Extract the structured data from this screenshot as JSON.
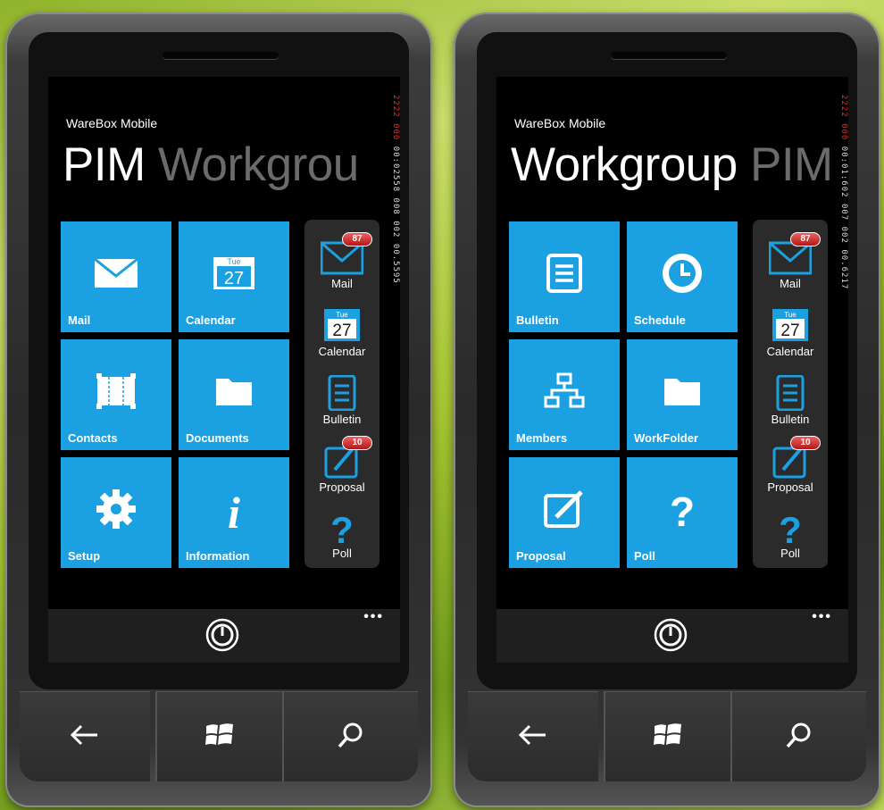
{
  "colors": {
    "tile": "#1ba1e2",
    "background": "#000000",
    "side_panel": "#2b2b2b",
    "badge": "#d32f2f"
  },
  "left": {
    "app_name": "WareBox Mobile",
    "title_active": "PIM",
    "title_next": "Workgrou",
    "debug_red": "2222 000",
    "debug_text": "00:02558 008 002 00.5595",
    "tiles": [
      {
        "label": "Mail",
        "icon": "mail-icon"
      },
      {
        "label": "Calendar",
        "icon": "calendar-icon",
        "day": "Tue",
        "date": "27"
      },
      {
        "label": "Contacts",
        "icon": "contacts-icon"
      },
      {
        "label": "Documents",
        "icon": "folder-icon"
      },
      {
        "label": "Setup",
        "icon": "gear-icon"
      },
      {
        "label": "Information",
        "icon": "info-icon"
      }
    ],
    "side": [
      {
        "label": "Mail",
        "icon": "mail-icon",
        "badge": "87"
      },
      {
        "label": "Calendar",
        "icon": "calendar-icon",
        "day": "Tue",
        "date": "27"
      },
      {
        "label": "Bulletin",
        "icon": "bulletin-icon"
      },
      {
        "label": "Proposal",
        "icon": "proposal-icon",
        "badge": "10"
      },
      {
        "label": "Poll",
        "icon": "question-icon"
      }
    ],
    "appbar_more": "•••"
  },
  "right": {
    "app_name": "WareBox Mobile",
    "title_active": "Workgroup",
    "title_next": "PIM",
    "debug_red": "2222 000",
    "debug_text": "00:01:602 007 002 00.6217",
    "tiles": [
      {
        "label": "Bulletin",
        "icon": "bulletin-icon"
      },
      {
        "label": "Schedule",
        "icon": "clock-icon"
      },
      {
        "label": "Members",
        "icon": "org-chart-icon"
      },
      {
        "label": "WorkFolder",
        "icon": "folder-icon"
      },
      {
        "label": "Proposal",
        "icon": "proposal-icon"
      },
      {
        "label": "Poll",
        "icon": "question-icon"
      }
    ],
    "side": [
      {
        "label": "Mail",
        "icon": "mail-icon",
        "badge": "87"
      },
      {
        "label": "Calendar",
        "icon": "calendar-icon",
        "day": "Tue",
        "date": "27"
      },
      {
        "label": "Bulletin",
        "icon": "bulletin-icon"
      },
      {
        "label": "Proposal",
        "icon": "proposal-icon",
        "badge": "10"
      },
      {
        "label": "Poll",
        "icon": "question-icon"
      }
    ],
    "appbar_more": "•••"
  }
}
